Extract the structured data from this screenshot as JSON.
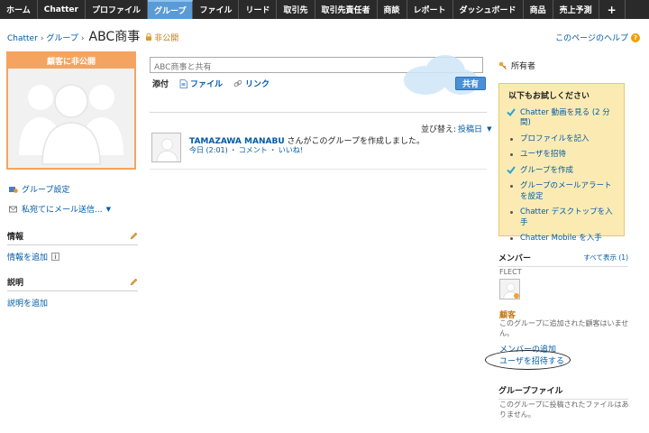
{
  "tabs": [
    {
      "label": "ホーム",
      "active": false
    },
    {
      "label": "Chatter",
      "active": false
    },
    {
      "label": "プロファイル",
      "active": false
    },
    {
      "label": "グループ",
      "active": true
    },
    {
      "label": "ファイル",
      "active": false
    },
    {
      "label": "リード",
      "active": false
    },
    {
      "label": "取引先",
      "active": false
    },
    {
      "label": "取引先責任者",
      "active": false
    },
    {
      "label": "商談",
      "active": false
    },
    {
      "label": "レポート",
      "active": false
    },
    {
      "label": "ダッシュボード",
      "active": false
    },
    {
      "label": "商品",
      "active": false
    },
    {
      "label": "売上予測",
      "active": false
    }
  ],
  "tab_plus": "+",
  "breadcrumb": {
    "root": "Chatter",
    "sep": "›",
    "groups": "グループ",
    "title": "ABC商事",
    "privacy": "非公開"
  },
  "help_link": "このページのヘルプ",
  "help_icon_glyph": "?",
  "profile": {
    "header": "顧客に非公開"
  },
  "left_links": {
    "group_settings": "グループ設定",
    "email": "私宛てにメール送信..."
  },
  "info_section": {
    "title": "情報",
    "link": "情報を追加",
    "badge": "i"
  },
  "description_section": {
    "title": "説明",
    "link": "説明を追加"
  },
  "share": {
    "placeholder": "ABC商事と共有",
    "attach_label": "添付",
    "file": "ファイル",
    "link": "リンク",
    "button": "共有"
  },
  "sort": {
    "label": "並び替え:",
    "value": "投稿日"
  },
  "feed": {
    "user": "TAMAZAWA MANABU",
    "action": "さんがこのグループを作成しました。",
    "time": "今日 (2:01)",
    "comment": "コメント",
    "like": "いいね!",
    "dot": "・"
  },
  "owner_label": "所有者",
  "try_box": {
    "title": "以下もお試しください",
    "items": [
      {
        "label": "Chatter 動画を見る (2 分間)",
        "done": true
      },
      {
        "label": "プロファイルを記入",
        "done": false
      },
      {
        "label": "ユーザを招待",
        "done": false
      },
      {
        "label": "グループを作成",
        "done": true
      },
      {
        "label": "グループのメールアラートを設定",
        "done": false
      },
      {
        "label": "Chatter デスクトップを入手",
        "done": false
      },
      {
        "label": "Chatter Mobile を入手",
        "done": false
      }
    ]
  },
  "members": {
    "title": "メンバー",
    "show_all": "すべて表示 (1)",
    "member_name": "FLECT",
    "customer_label": "顧客",
    "customer_note": "このグループに追加された顧客はいません。",
    "add_member": "メンバーの追加",
    "invite_user": "ユーザを招待する"
  },
  "files": {
    "title": "グループファイル",
    "note": "このグループに投稿されたファイルはありません。"
  },
  "colors": {
    "tabbar": "#2a2a2a",
    "active_tab": "#5a9bd6",
    "link": "#015ba7",
    "accent_orange": "#f4a460",
    "try_box_bg": "#fbebb3"
  }
}
